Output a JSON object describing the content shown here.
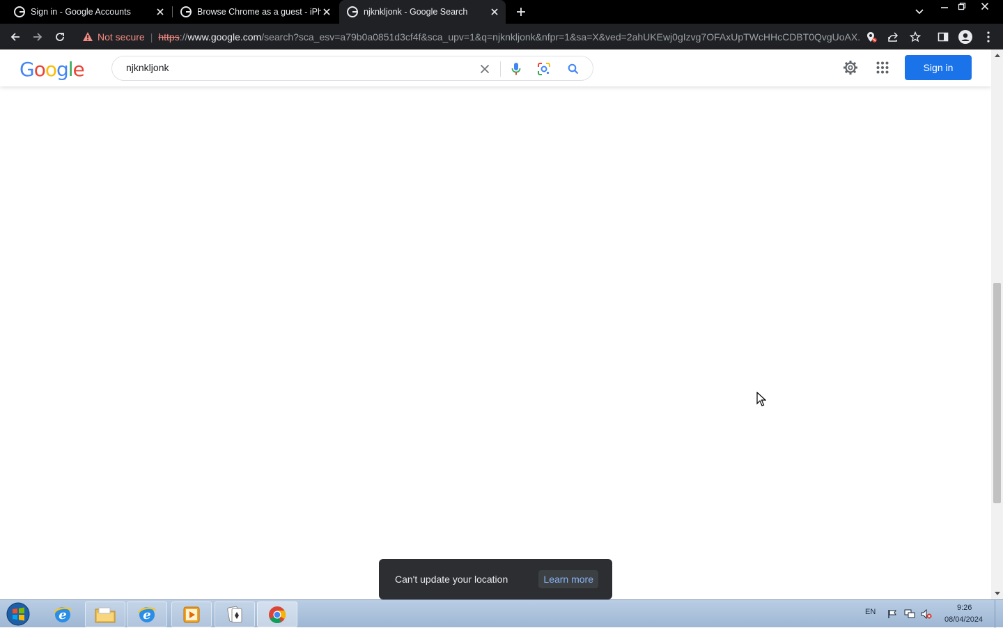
{
  "browser": {
    "tabs": [
      {
        "title": "Sign in - Google Accounts",
        "active": false
      },
      {
        "title": "Browse Chrome as a guest - iPhone",
        "active": false
      },
      {
        "title": "njknkljonk - Google Search",
        "active": true
      }
    ],
    "omnibox": {
      "security_label": "Not secure",
      "url_scheme": "https",
      "url_separator": "://",
      "url_host": "www.google.com",
      "url_rest": "/search?sca_esv=a79b0a0851d3cf4f&sca_upv=1&q=njknkljonk&nfpr=1&sa=X&ved=2ahUKEwj0gIzvg7OFAxUpTWcHHcCDBT0QvgUoAX..."
    }
  },
  "google": {
    "logo_letters": [
      "G",
      "o",
      "o",
      "g",
      "l",
      "e"
    ],
    "search_query": "njknkljonk",
    "signin_label": "Sign in"
  },
  "snackbar": {
    "message": "Can't update your location",
    "link_label": "Learn more"
  },
  "taskbar": {
    "language": "EN",
    "time": "9:26",
    "date": "08/04/2024"
  },
  "colors": {
    "google_blue": "#4285f4",
    "google_red": "#ea4335",
    "google_yellow": "#fbbc05",
    "google_green": "#34a853",
    "signin_button": "#1a73e8",
    "not_secure_red": "#f28b82"
  }
}
